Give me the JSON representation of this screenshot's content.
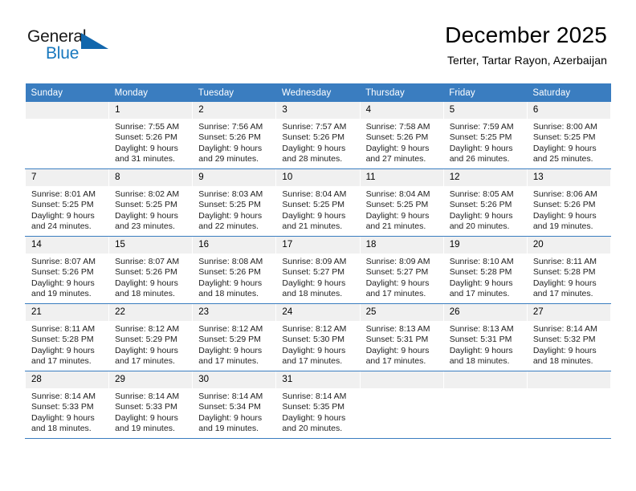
{
  "logo": {
    "word1": "General",
    "word2": "Blue",
    "triangle_color": "#1267ad",
    "blue_color": "#1878be"
  },
  "header": {
    "title": "December 2025",
    "subtitle": "Terter, Tartar Rayon, Azerbaijan"
  },
  "theme": {
    "header_bg": "#3a7dc0",
    "daynum_bg": "#f0f0f0",
    "grid_line": "#3a7dc0"
  },
  "weekday_headers": [
    "Sunday",
    "Monday",
    "Tuesday",
    "Wednesday",
    "Thursday",
    "Friday",
    "Saturday"
  ],
  "weeks": [
    [
      {
        "day": "",
        "blank": true,
        "sunrise": "",
        "sunset": "",
        "daylight1": "",
        "daylight2": ""
      },
      {
        "day": "1",
        "sunrise": "Sunrise: 7:55 AM",
        "sunset": "Sunset: 5:26 PM",
        "daylight1": "Daylight: 9 hours",
        "daylight2": "and 31 minutes."
      },
      {
        "day": "2",
        "sunrise": "Sunrise: 7:56 AM",
        "sunset": "Sunset: 5:26 PM",
        "daylight1": "Daylight: 9 hours",
        "daylight2": "and 29 minutes."
      },
      {
        "day": "3",
        "sunrise": "Sunrise: 7:57 AM",
        "sunset": "Sunset: 5:26 PM",
        "daylight1": "Daylight: 9 hours",
        "daylight2": "and 28 minutes."
      },
      {
        "day": "4",
        "sunrise": "Sunrise: 7:58 AM",
        "sunset": "Sunset: 5:26 PM",
        "daylight1": "Daylight: 9 hours",
        "daylight2": "and 27 minutes."
      },
      {
        "day": "5",
        "sunrise": "Sunrise: 7:59 AM",
        "sunset": "Sunset: 5:25 PM",
        "daylight1": "Daylight: 9 hours",
        "daylight2": "and 26 minutes."
      },
      {
        "day": "6",
        "sunrise": "Sunrise: 8:00 AM",
        "sunset": "Sunset: 5:25 PM",
        "daylight1": "Daylight: 9 hours",
        "daylight2": "and 25 minutes."
      }
    ],
    [
      {
        "day": "7",
        "sunrise": "Sunrise: 8:01 AM",
        "sunset": "Sunset: 5:25 PM",
        "daylight1": "Daylight: 9 hours",
        "daylight2": "and 24 minutes."
      },
      {
        "day": "8",
        "sunrise": "Sunrise: 8:02 AM",
        "sunset": "Sunset: 5:25 PM",
        "daylight1": "Daylight: 9 hours",
        "daylight2": "and 23 minutes."
      },
      {
        "day": "9",
        "sunrise": "Sunrise: 8:03 AM",
        "sunset": "Sunset: 5:25 PM",
        "daylight1": "Daylight: 9 hours",
        "daylight2": "and 22 minutes."
      },
      {
        "day": "10",
        "sunrise": "Sunrise: 8:04 AM",
        "sunset": "Sunset: 5:25 PM",
        "daylight1": "Daylight: 9 hours",
        "daylight2": "and 21 minutes."
      },
      {
        "day": "11",
        "sunrise": "Sunrise: 8:04 AM",
        "sunset": "Sunset: 5:25 PM",
        "daylight1": "Daylight: 9 hours",
        "daylight2": "and 21 minutes."
      },
      {
        "day": "12",
        "sunrise": "Sunrise: 8:05 AM",
        "sunset": "Sunset: 5:26 PM",
        "daylight1": "Daylight: 9 hours",
        "daylight2": "and 20 minutes."
      },
      {
        "day": "13",
        "sunrise": "Sunrise: 8:06 AM",
        "sunset": "Sunset: 5:26 PM",
        "daylight1": "Daylight: 9 hours",
        "daylight2": "and 19 minutes."
      }
    ],
    [
      {
        "day": "14",
        "sunrise": "Sunrise: 8:07 AM",
        "sunset": "Sunset: 5:26 PM",
        "daylight1": "Daylight: 9 hours",
        "daylight2": "and 19 minutes."
      },
      {
        "day": "15",
        "sunrise": "Sunrise: 8:07 AM",
        "sunset": "Sunset: 5:26 PM",
        "daylight1": "Daylight: 9 hours",
        "daylight2": "and 18 minutes."
      },
      {
        "day": "16",
        "sunrise": "Sunrise: 8:08 AM",
        "sunset": "Sunset: 5:26 PM",
        "daylight1": "Daylight: 9 hours",
        "daylight2": "and 18 minutes."
      },
      {
        "day": "17",
        "sunrise": "Sunrise: 8:09 AM",
        "sunset": "Sunset: 5:27 PM",
        "daylight1": "Daylight: 9 hours",
        "daylight2": "and 18 minutes."
      },
      {
        "day": "18",
        "sunrise": "Sunrise: 8:09 AM",
        "sunset": "Sunset: 5:27 PM",
        "daylight1": "Daylight: 9 hours",
        "daylight2": "and 17 minutes."
      },
      {
        "day": "19",
        "sunrise": "Sunrise: 8:10 AM",
        "sunset": "Sunset: 5:28 PM",
        "daylight1": "Daylight: 9 hours",
        "daylight2": "and 17 minutes."
      },
      {
        "day": "20",
        "sunrise": "Sunrise: 8:11 AM",
        "sunset": "Sunset: 5:28 PM",
        "daylight1": "Daylight: 9 hours",
        "daylight2": "and 17 minutes."
      }
    ],
    [
      {
        "day": "21",
        "sunrise": "Sunrise: 8:11 AM",
        "sunset": "Sunset: 5:28 PM",
        "daylight1": "Daylight: 9 hours",
        "daylight2": "and 17 minutes."
      },
      {
        "day": "22",
        "sunrise": "Sunrise: 8:12 AM",
        "sunset": "Sunset: 5:29 PM",
        "daylight1": "Daylight: 9 hours",
        "daylight2": "and 17 minutes."
      },
      {
        "day": "23",
        "sunrise": "Sunrise: 8:12 AM",
        "sunset": "Sunset: 5:29 PM",
        "daylight1": "Daylight: 9 hours",
        "daylight2": "and 17 minutes."
      },
      {
        "day": "24",
        "sunrise": "Sunrise: 8:12 AM",
        "sunset": "Sunset: 5:30 PM",
        "daylight1": "Daylight: 9 hours",
        "daylight2": "and 17 minutes."
      },
      {
        "day": "25",
        "sunrise": "Sunrise: 8:13 AM",
        "sunset": "Sunset: 5:31 PM",
        "daylight1": "Daylight: 9 hours",
        "daylight2": "and 17 minutes."
      },
      {
        "day": "26",
        "sunrise": "Sunrise: 8:13 AM",
        "sunset": "Sunset: 5:31 PM",
        "daylight1": "Daylight: 9 hours",
        "daylight2": "and 18 minutes."
      },
      {
        "day": "27",
        "sunrise": "Sunrise: 8:14 AM",
        "sunset": "Sunset: 5:32 PM",
        "daylight1": "Daylight: 9 hours",
        "daylight2": "and 18 minutes."
      }
    ],
    [
      {
        "day": "28",
        "sunrise": "Sunrise: 8:14 AM",
        "sunset": "Sunset: 5:33 PM",
        "daylight1": "Daylight: 9 hours",
        "daylight2": "and 18 minutes."
      },
      {
        "day": "29",
        "sunrise": "Sunrise: 8:14 AM",
        "sunset": "Sunset: 5:33 PM",
        "daylight1": "Daylight: 9 hours",
        "daylight2": "and 19 minutes."
      },
      {
        "day": "30",
        "sunrise": "Sunrise: 8:14 AM",
        "sunset": "Sunset: 5:34 PM",
        "daylight1": "Daylight: 9 hours",
        "daylight2": "and 19 minutes."
      },
      {
        "day": "31",
        "sunrise": "Sunrise: 8:14 AM",
        "sunset": "Sunset: 5:35 PM",
        "daylight1": "Daylight: 9 hours",
        "daylight2": "and 20 minutes."
      },
      {
        "day": "",
        "blank": true,
        "sunrise": "",
        "sunset": "",
        "daylight1": "",
        "daylight2": ""
      },
      {
        "day": "",
        "blank": true,
        "sunrise": "",
        "sunset": "",
        "daylight1": "",
        "daylight2": ""
      },
      {
        "day": "",
        "blank": true,
        "sunrise": "",
        "sunset": "",
        "daylight1": "",
        "daylight2": ""
      }
    ]
  ]
}
